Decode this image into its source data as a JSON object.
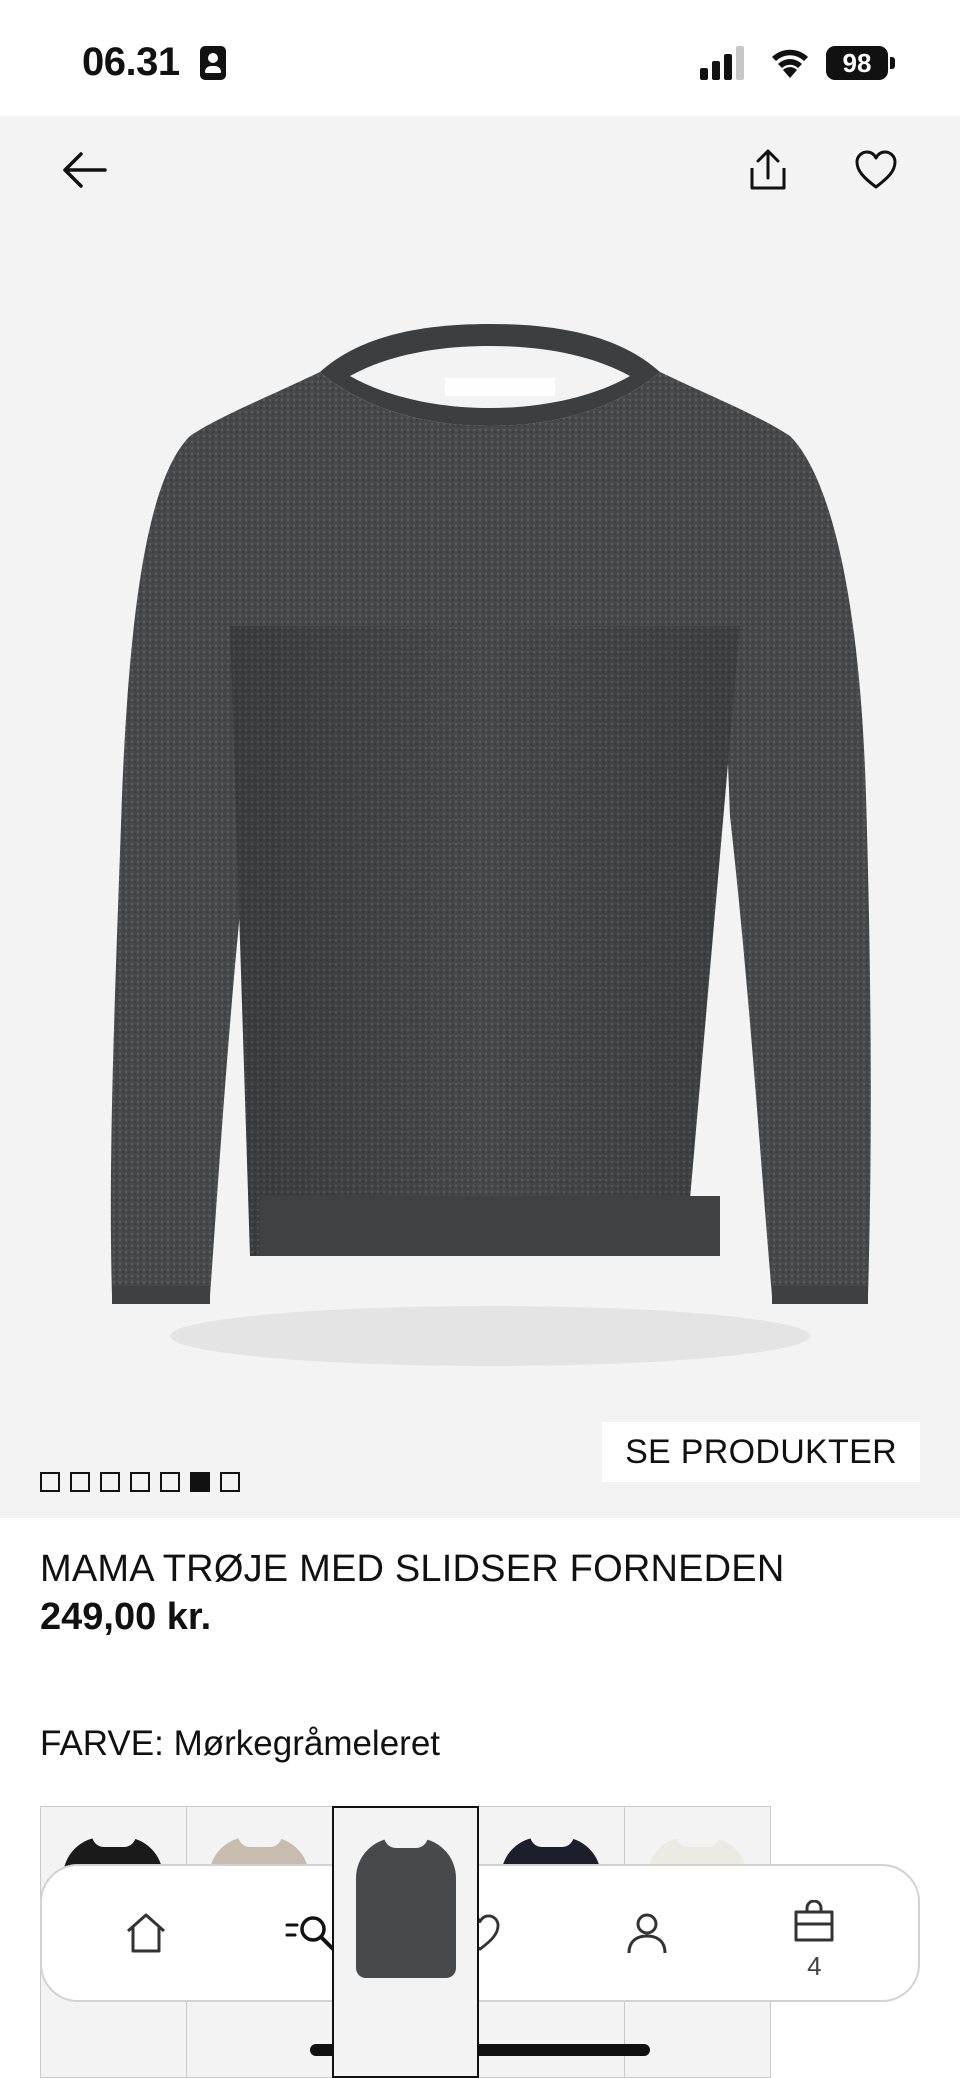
{
  "status_bar": {
    "time": "06.31",
    "battery": "98"
  },
  "product": {
    "pager_total": 7,
    "pager_active_index": 5,
    "see_products_label": "SE PRODUKTER",
    "title": "MAMA TRØJE MED SLIDSER FORNEDEN",
    "price": "249,00 kr.",
    "color_label": "FARVE: Mørkegråmeleret",
    "swatches": [
      {
        "name": "black",
        "color": "#1a1a1a"
      },
      {
        "name": "beige",
        "color": "#c8bcaf"
      },
      {
        "name": "dark-grey-melange",
        "color": "#47494b",
        "selected": true
      },
      {
        "name": "navy",
        "color": "#1c1f2b"
      },
      {
        "name": "cream",
        "color": "#ecebe3"
      }
    ]
  },
  "bottom_nav": {
    "items": [
      "home-icon",
      "search-icon",
      "heart-icon",
      "account-icon",
      "bag-icon"
    ],
    "bag_count": "4"
  },
  "colors": {
    "hero_bg": "#f3f3f4",
    "sweater": "#46484a",
    "text": "#111111"
  }
}
